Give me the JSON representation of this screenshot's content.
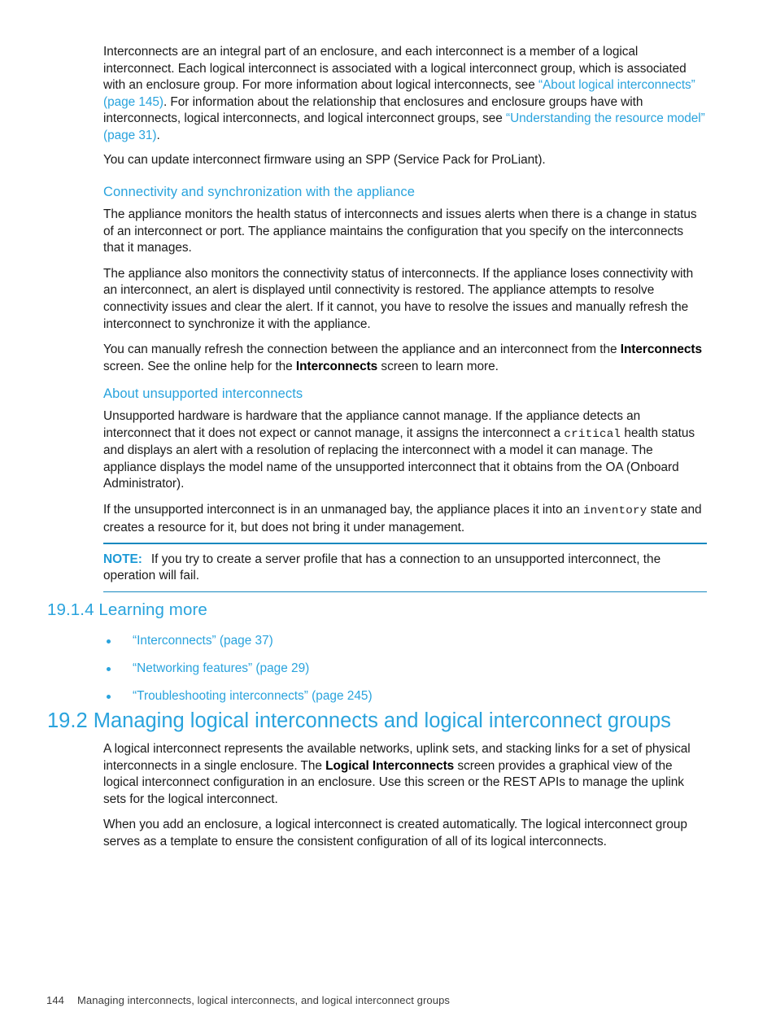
{
  "page": {
    "number": "144",
    "footer_title": "Managing interconnects, logical interconnects, and logical interconnect groups"
  },
  "colors": {
    "accent": "#29a3dd",
    "rule": "#1788bf",
    "body_text": "#1a1a1a"
  },
  "intro": {
    "p1_part1": "Interconnects are an integral part of an enclosure, and each interconnect is a member of a logical interconnect. Each logical interconnect is associated with a logical interconnect group, which is associated with an enclosure group. For more information about logical interconnects, see ",
    "p1_link1": "“About logical interconnects” (page 145)",
    "p1_part2": ". For information about the relationship that enclosures and enclosure groups have with interconnects, logical interconnects, and logical interconnect groups, see ",
    "p1_link2": "“Understanding the resource model” (page 31)",
    "p1_part3": ".",
    "p2": "You can update interconnect firmware using an SPP (Service Pack for ProLiant)."
  },
  "connectivity": {
    "heading": "Connectivity and synchronization with the appliance",
    "p1": "The appliance monitors the health status of interconnects and issues alerts when there is a change in status of an interconnect or port. The appliance maintains the configuration that you specify on the interconnects that it manages.",
    "p2": "The appliance also monitors the connectivity status of interconnects. If the appliance loses connectivity with an interconnect, an alert is displayed until connectivity is restored. The appliance attempts to resolve connectivity issues and clear the alert. If it cannot, you have to resolve the issues and manually refresh the interconnect to synchronize it with the appliance.",
    "p3_part1": "You can manually refresh the connection between the appliance and an interconnect from the ",
    "p3_bold1": "Interconnects",
    "p3_part2": " screen.  See the online help for the ",
    "p3_bold2": "Interconnects",
    "p3_part3": " screen to learn more."
  },
  "unsupported": {
    "heading": "About unsupported interconnects",
    "p1_part1": "Unsupported hardware is hardware that the appliance cannot manage. If the appliance detects an interconnect that it does not expect or cannot manage, it assigns the interconnect a ",
    "p1_mono": "critical",
    "p1_part2": " health status and displays an alert with a resolution of replacing the interconnect with a model it can manage. The appliance displays the model name of the unsupported interconnect that it obtains from the OA (Onboard Administrator).",
    "p2_part1": "If the unsupported interconnect is in an unmanaged bay, the appliance places it into an ",
    "p2_mono": "inventory",
    "p2_part2": " state and creates a resource for it, but does not bring it under management."
  },
  "note": {
    "label": "NOTE:",
    "text": "If you try to create a server profile that has a connection to an unsupported interconnect, the operation will fail."
  },
  "learning_more": {
    "heading": "19.1.4 Learning more",
    "items": [
      "“Interconnects” (page 37)",
      "“Networking features” (page 29)",
      "“Troubleshooting interconnects” (page 245)"
    ]
  },
  "section_19_2": {
    "heading": "19.2 Managing logical interconnects and logical interconnect groups",
    "p1_part1": "A logical interconnect represents the available networks, uplink sets, and stacking links for a set of physical interconnects in a single enclosure. The ",
    "p1_bold": "Logical Interconnects",
    "p1_part2": " screen provides a graphical view of the logical interconnect configuration in an enclosure. Use this screen or the REST APIs to manage the uplink sets for the logical interconnect.",
    "p2": "When you add an enclosure, a logical interconnect is created automatically. The logical interconnect group serves as a template to ensure the consistent configuration of all of its logical interconnects."
  }
}
